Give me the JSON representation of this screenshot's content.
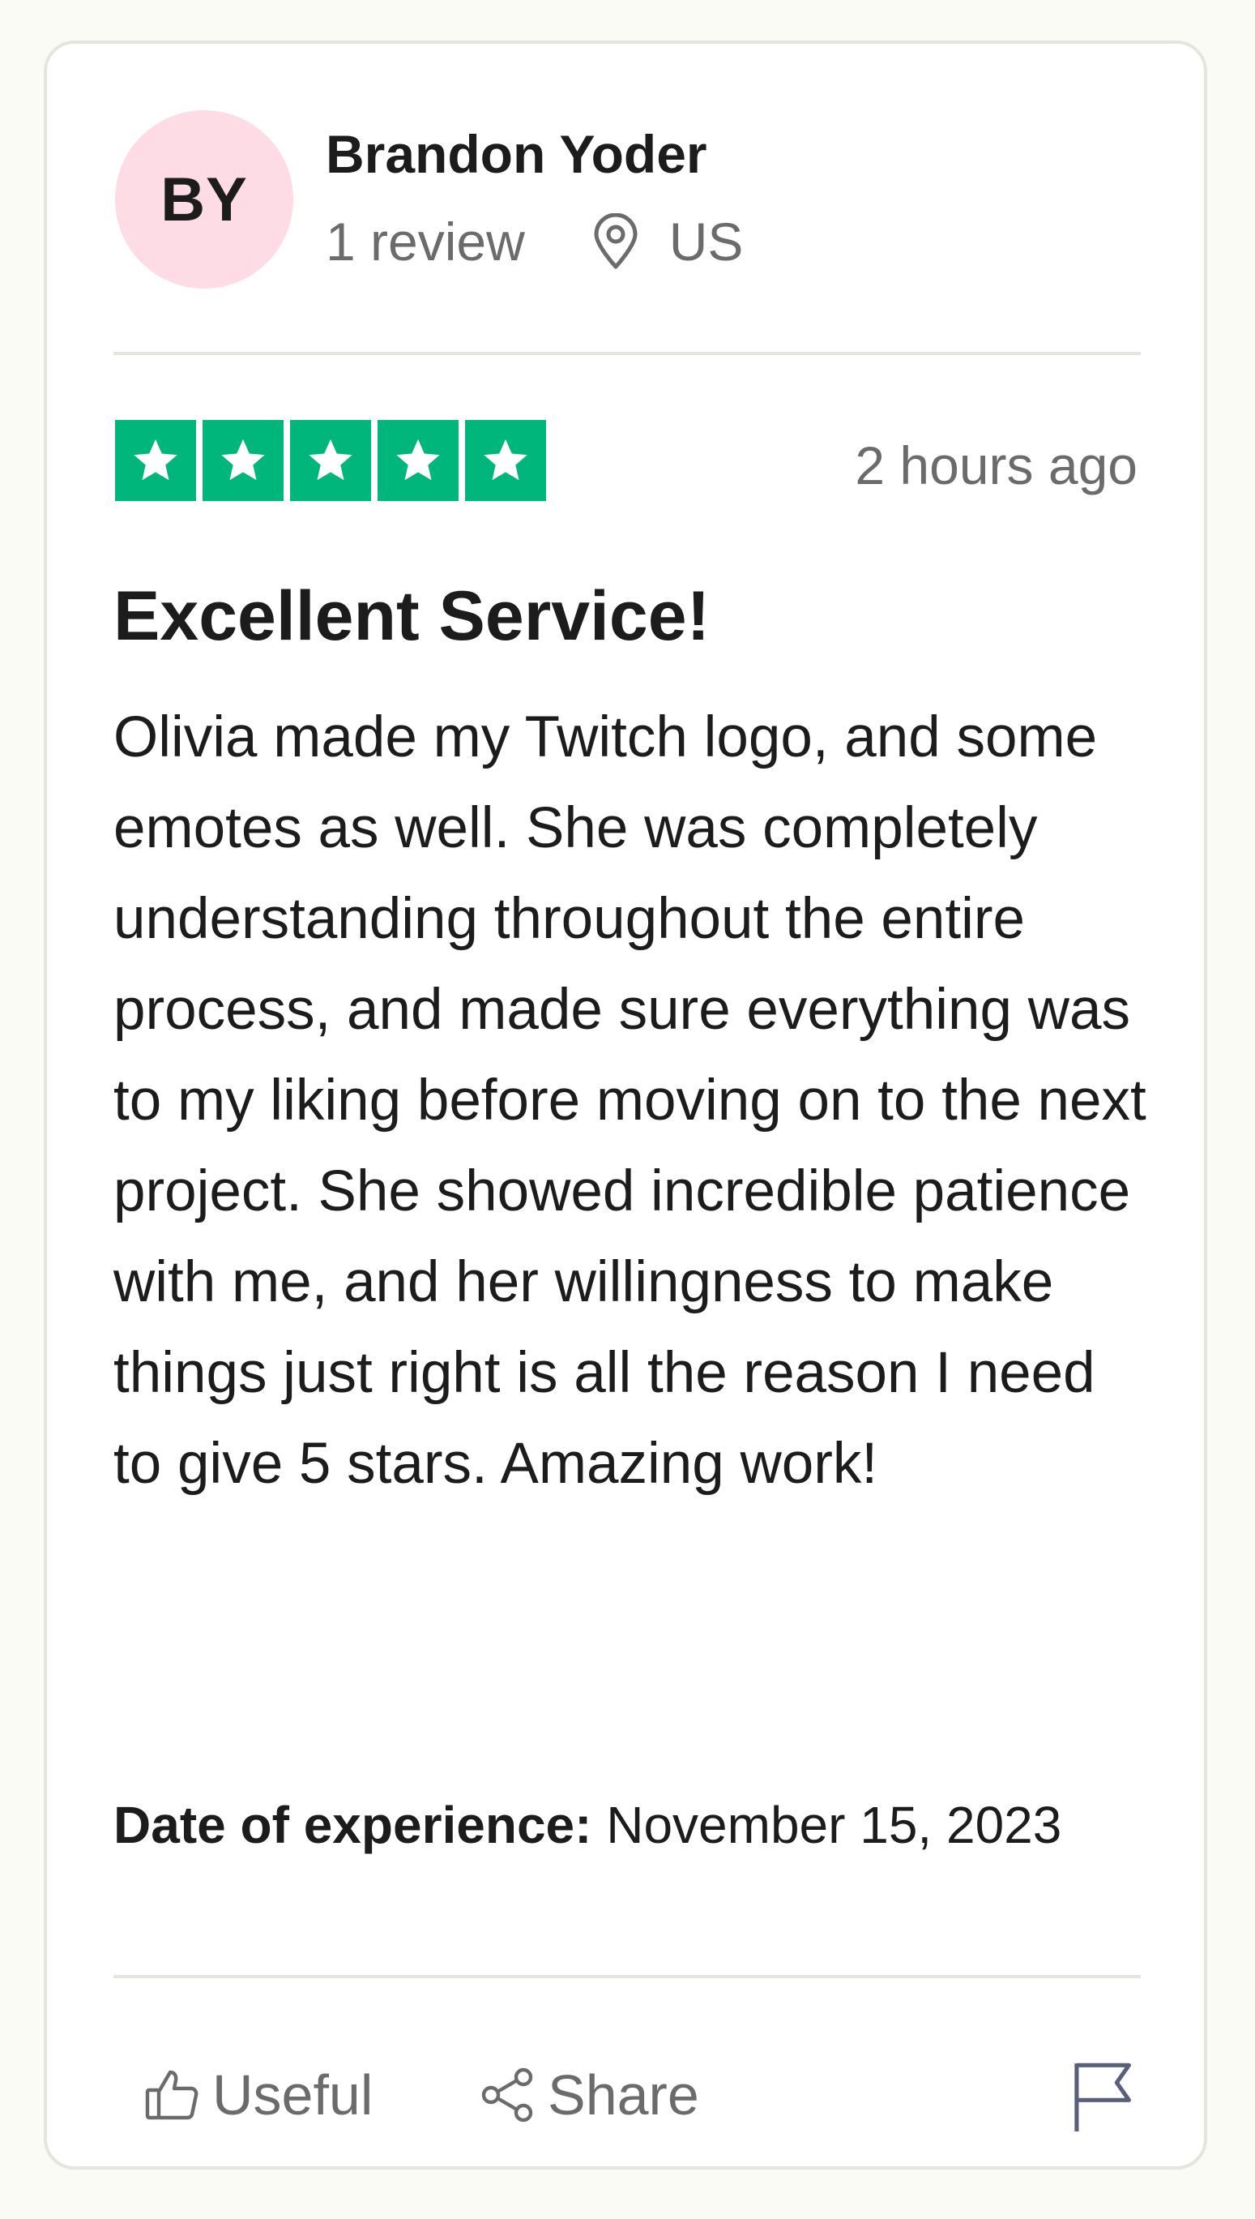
{
  "reviewer": {
    "initials": "BY",
    "avatar_color": "#fddce5",
    "name": "Brandon Yoder",
    "review_count": "1 review",
    "location_icon": "location-pin-icon",
    "country": "US"
  },
  "review": {
    "rating": 5,
    "max_rating": 5,
    "star_color": "#00b67a",
    "time_ago": "2 hours ago",
    "title": "Excellent Service!",
    "body": "Olivia made my Twitch logo, and some emotes as well. She was completely understanding throughout the entire process, and made sure everything was to my liking before moving on to the next project. She showed incredible patience with me, and her willingness to make things just right is all the reason I need to give 5 stars. Amazing work!",
    "date_label": "Date of experience:",
    "date_value": "November 15, 2023"
  },
  "actions": {
    "useful_label": "Useful",
    "useful_icon": "thumbs-up-icon",
    "share_label": "Share",
    "share_icon": "share-icon",
    "flag_icon": "flag-icon"
  }
}
